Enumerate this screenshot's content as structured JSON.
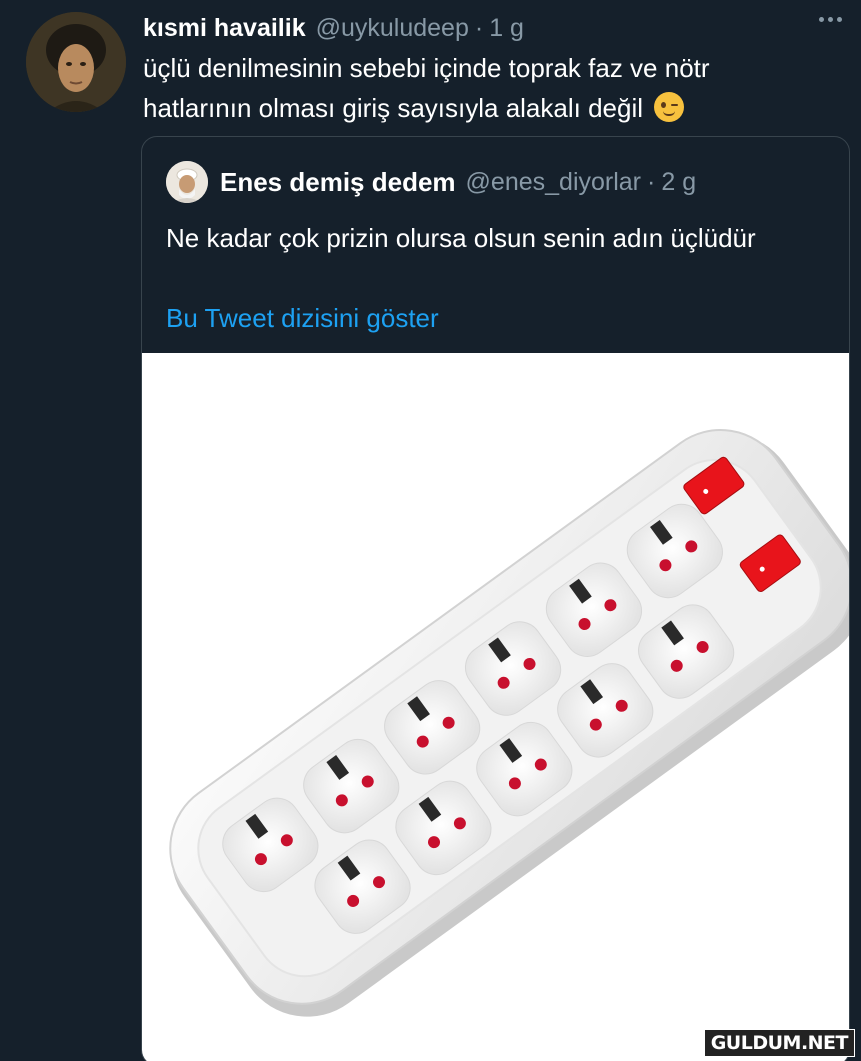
{
  "tweet": {
    "author_name": "kısmi havailik",
    "author_handle": "@uykuludeep",
    "separator": "·",
    "time": "1 g",
    "text": "üçlü denilmesinin sebebi içinde toprak faz ve nötr hatlarının olması giriş sayısıyla alakalı değil",
    "emoji": "winking-face-emoji",
    "more_icon": "more-horizontal-icon"
  },
  "quoted_tweet": {
    "author_name": "Enes demiş dedem",
    "author_handle": "@enes_diyorlar",
    "separator": "·",
    "time": "2 g",
    "text": "Ne kadar çok prizin olursa olsun senin adın üçlüdür",
    "show_thread_link": "Bu Tweet dizisini göster",
    "media": "power-strip-photo"
  },
  "watermark": "GULDUM.NET",
  "colors": {
    "background": "#15202b",
    "secondary_text": "#8899a6",
    "link": "#1da1f2",
    "border": "#38444d",
    "switch_red": "#e8141b"
  }
}
